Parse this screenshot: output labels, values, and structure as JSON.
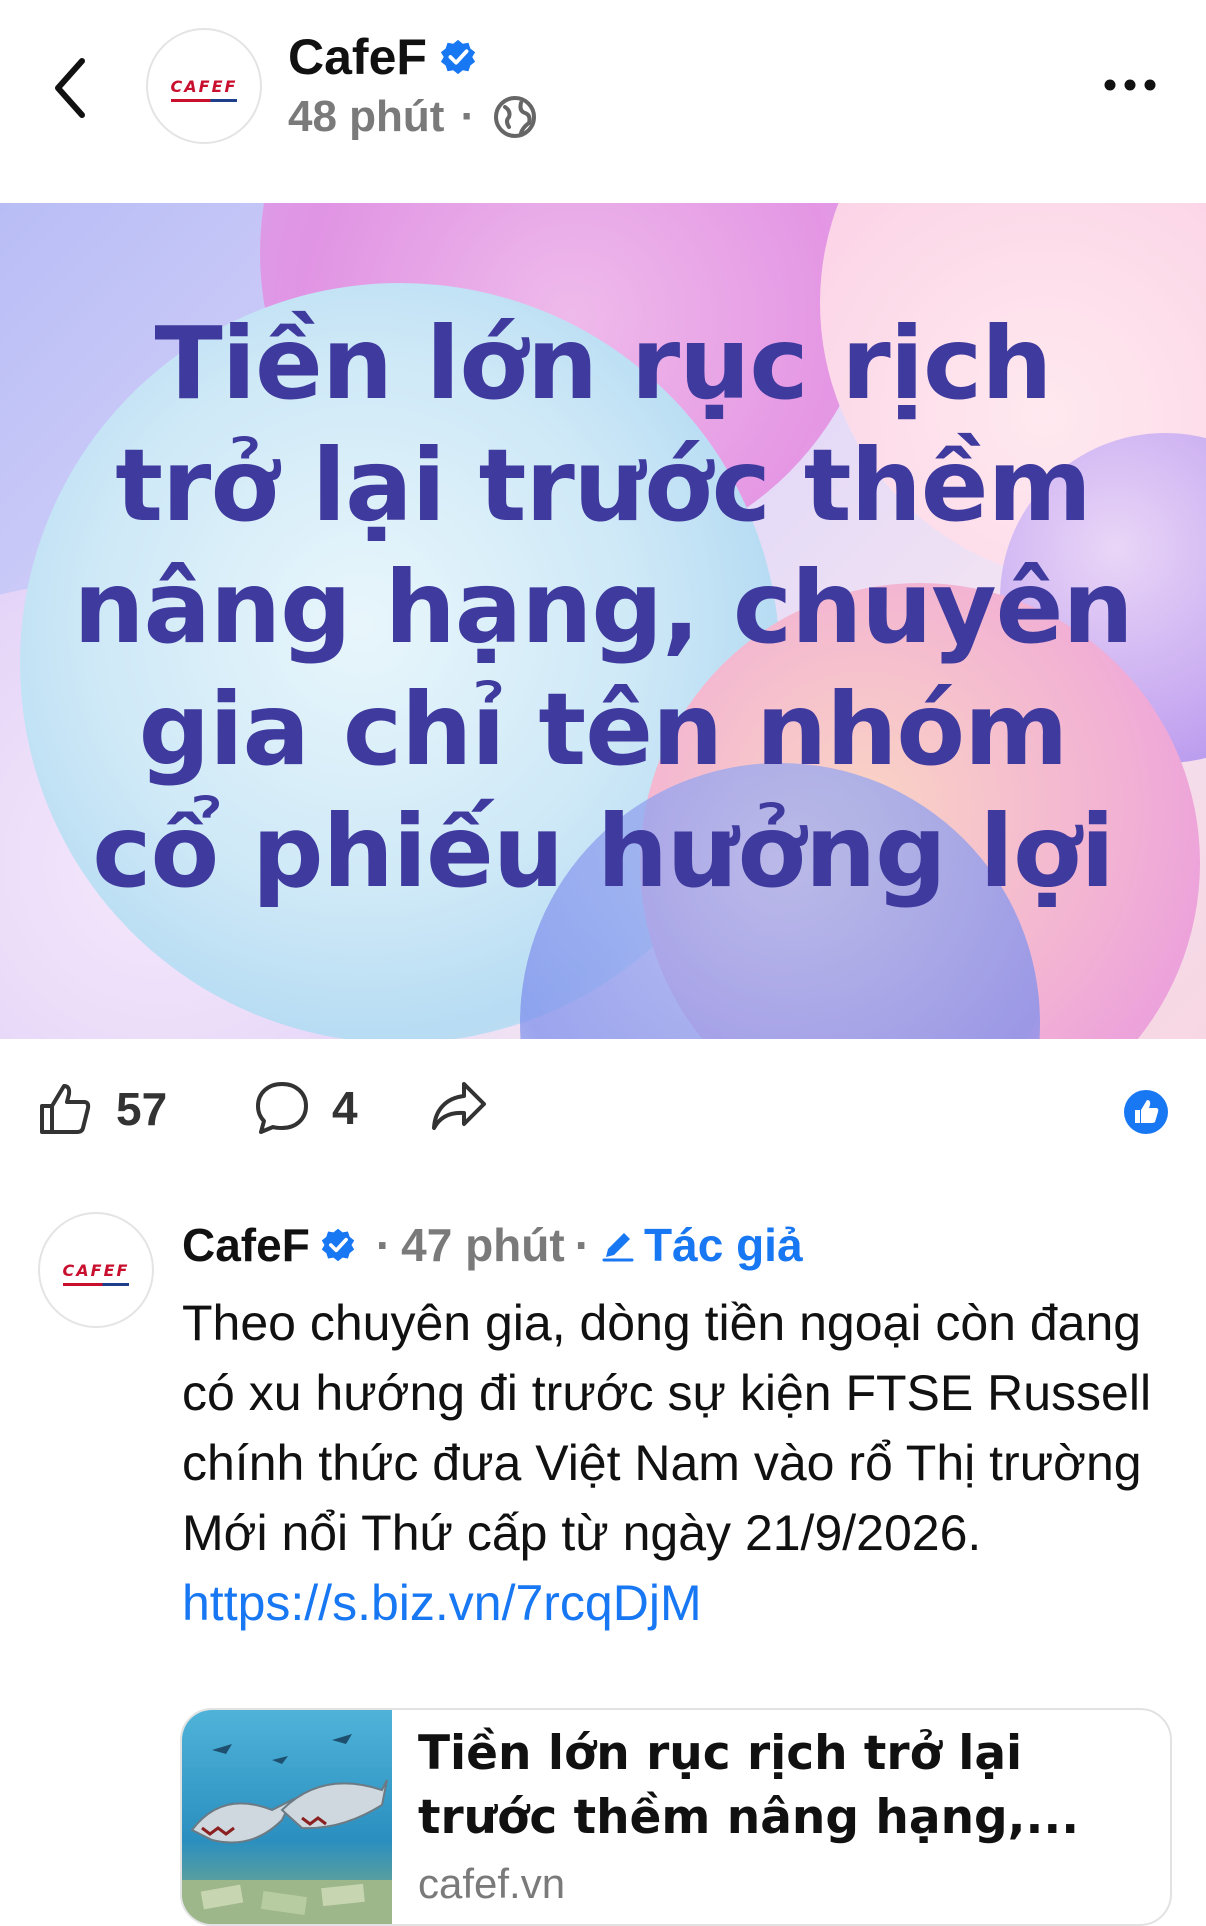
{
  "post": {
    "author": "CafeF",
    "time": "48 phút",
    "separator": "·",
    "logo_text": "CAFEF",
    "banner_text": "Tiền lớn rục rịch trở lại trước thềm nâng hạng, chuyên gia chỉ tên nhóm cổ phiếu hưởng lợi"
  },
  "actions": {
    "likes": "57",
    "comments": "4"
  },
  "comment": {
    "author": "CafeF",
    "separator": "·",
    "time": "47 phút",
    "tag": "Tác giả",
    "text": "Theo chuyên gia, dòng tiền ngoại còn đang có xu hướng đi trước sự kiện FTSE Russell chính thức đưa Việt Nam vào rổ Thị trường Mới nổi Thứ cấp từ ngày 21/9/2026. ",
    "link": "https://s.biz.vn/7rcqDjM"
  },
  "preview": {
    "title": "Tiền lớn rục rịch trở lại trước thềm nâng hạng,...",
    "domain": "cafef.vn"
  },
  "colors": {
    "accent": "#1877f2",
    "banner_text": "#3f3a9e",
    "muted": "#7a7a7a"
  }
}
